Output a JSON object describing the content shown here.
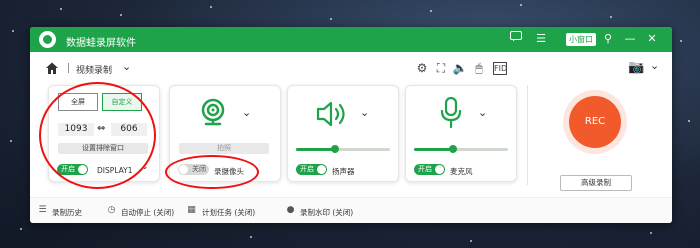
{
  "app": {
    "title": "数据蛙录屏软件",
    "mini_window_label": "小窗口"
  },
  "toolbar": {
    "mode_label": "视频录制"
  },
  "screen_card": {
    "fullscreen_label": "全屏",
    "custom_label": "自定义",
    "width": "1093",
    "height": "606",
    "lock_window_label": "设置排除窗口",
    "toggle_label": "开启",
    "display_label": "DISPLAY1"
  },
  "camera_card": {
    "photo_label": "拍照",
    "toggle_label": "关闭",
    "label": "录摄像头"
  },
  "speaker_card": {
    "toggle_label": "开启",
    "label": "扬声器",
    "volume": 0.42
  },
  "mic_card": {
    "toggle_label": "开启",
    "label": "麦克风",
    "volume": 0.42
  },
  "rec": {
    "label": "REC",
    "advanced_label": "高级录制"
  },
  "bottombar": {
    "history_label": "录制历史",
    "auto_stop_label": "自动停止 (关闭)",
    "schedule_label": "计划任务 (关闭)",
    "watermark_label": "录制水印 (关闭)"
  },
  "colors": {
    "accent": "#1fa34a",
    "rec": "#f25a2c",
    "annotation": "#e11111"
  }
}
